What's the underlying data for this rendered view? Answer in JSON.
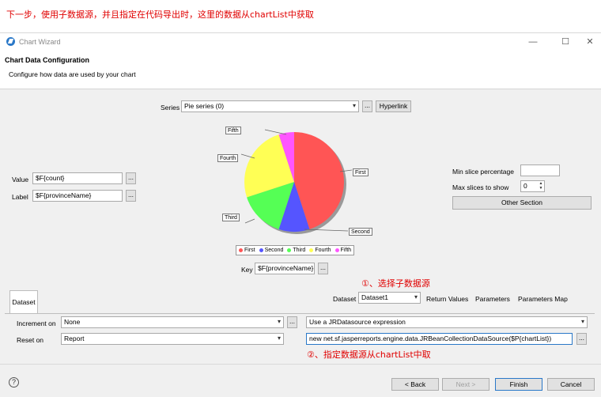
{
  "annotations": {
    "top": "下一步，使用子数据源，并且指定在代码导出时，这里的数据从chartList中获取",
    "step1": "①、选择子数据源",
    "step2": "②、指定数据源从chartList中取"
  },
  "window": {
    "title": "Chart Wizard",
    "minimize": "—",
    "maximize": "☐",
    "close": "✕"
  },
  "header": {
    "title": "Chart Data Configuration",
    "description": "Configure how data are used by your chart"
  },
  "series": {
    "label": "Series",
    "value": "Pie series (0)",
    "more": "...",
    "hyperlink": "Hyperlink"
  },
  "value_field": {
    "label": "Value",
    "value": "$F{count}",
    "more": "..."
  },
  "label_field": {
    "label": "Label",
    "value": "$F{provinceName}",
    "more": "..."
  },
  "key_field": {
    "label": "Key",
    "value": "$F{provinceName}",
    "more": "..."
  },
  "right_panel": {
    "min_slice_label": "Min slice percentage",
    "min_slice_value": "",
    "max_slices_label": "Max slices to show",
    "max_slices_value": "0",
    "other_section": "Other Section"
  },
  "chart_data": {
    "type": "pie",
    "categories": [
      "First",
      "Second",
      "Third",
      "Fourth",
      "Fifth"
    ],
    "values": [
      45,
      10,
      15,
      25,
      5
    ],
    "colors": [
      "#ff5555",
      "#5555ff",
      "#55ff55",
      "#ffff55",
      "#ff55ff"
    ],
    "legend_position": "bottom"
  },
  "dataset_tab": {
    "label": "Dataset"
  },
  "dataset": {
    "label": "Dataset",
    "value": "Dataset1",
    "return_values": "Return Values",
    "parameters": "Parameters",
    "parameters_map": "Parameters Map"
  },
  "increment": {
    "label": "Increment on",
    "value": "None",
    "more": "..."
  },
  "reset": {
    "label": "Reset on",
    "value": "Report"
  },
  "datasource": {
    "type": "Use a JRDatasource expression",
    "expression": "new net.sf.jasperreports.engine.data.JRBeanCollectionDataSource($P{chartList})",
    "more": "..."
  },
  "footer": {
    "help": "?",
    "back": "< Back",
    "next": "Next >",
    "finish": "Finish",
    "cancel": "Cancel"
  },
  "icons": {
    "dropdown": "▾",
    "spin_up": "▲",
    "spin_down": "▼"
  }
}
